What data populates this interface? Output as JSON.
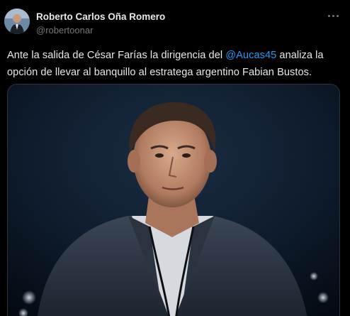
{
  "author": {
    "display_name": "Roberto Carlos Oña Romero",
    "handle": "@robertoonar"
  },
  "tweet": {
    "text_part1": "Ante la salida de César Farías la dirigencia del ",
    "mention": "@Aucas45",
    "text_part2": " analiza la opción de llevar al banquillo al estratega argentino Fabian Bustos."
  },
  "icons": {
    "more": "more-horizontal-icon",
    "avatar": "user-avatar"
  },
  "colors": {
    "background": "#000000",
    "text": "#e7e9ea",
    "secondary_text": "#71767b",
    "link": "#1d9bf0"
  }
}
